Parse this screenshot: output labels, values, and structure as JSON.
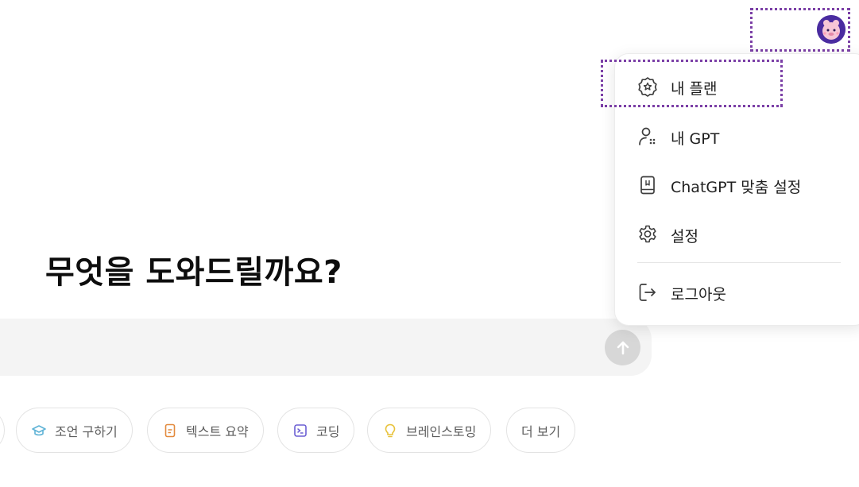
{
  "header": {
    "avatar_icon": "user-avatar-icon"
  },
  "main": {
    "title": "무엇을 도와드릴까요?",
    "prompt": {
      "placeholder": "",
      "value": "",
      "send_icon": "arrow-up-icon"
    },
    "chips": [
      {
        "label": "조언 구하기",
        "icon": "graduation-cap-icon",
        "color": "#5fb3d6"
      },
      {
        "label": "텍스트 요약",
        "icon": "document-icon",
        "color": "#e38a3e"
      },
      {
        "label": "코딩",
        "icon": "terminal-icon",
        "color": "#6b5fd3"
      },
      {
        "label": "브레인스토밍",
        "icon": "lightbulb-icon",
        "color": "#e8c23a"
      },
      {
        "label": "더 보기",
        "icon": "",
        "color": ""
      }
    ]
  },
  "menu": {
    "items": [
      {
        "label": "내 플랜",
        "icon": "plan-badge-icon"
      },
      {
        "label": "내 GPT",
        "icon": "user-grid-icon"
      },
      {
        "label": "ChatGPT 맞춤 설정",
        "icon": "customize-book-icon"
      },
      {
        "label": "설정",
        "icon": "gear-icon"
      },
      {
        "label": "로그아웃",
        "icon": "logout-icon"
      }
    ]
  },
  "colors": {
    "highlight": "#7b3fa6",
    "avatar_bg": "#4a2ca0",
    "prompt_bg": "#f4f4f4",
    "send_bg": "#d7d7d7"
  }
}
